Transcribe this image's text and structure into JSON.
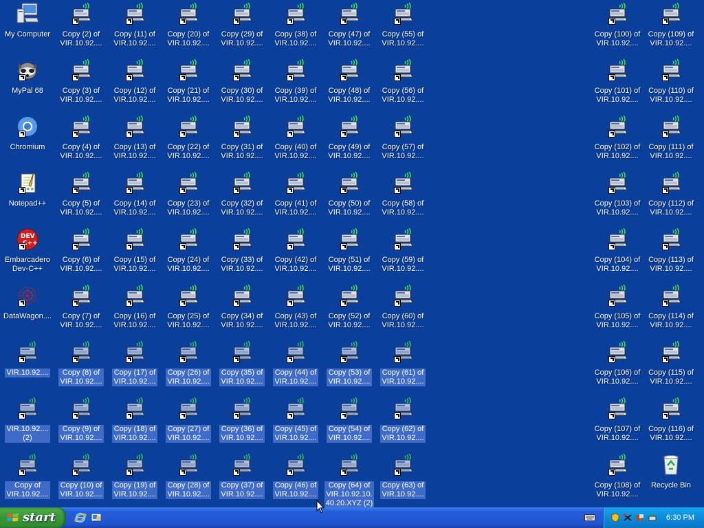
{
  "desktop": {
    "system_icons": [
      {
        "label": "My Computer",
        "icon": "my-computer-icon"
      },
      {
        "label": "MyPal 68",
        "icon": "mypal-browser-icon"
      },
      {
        "label": "Chromium",
        "icon": "chromium-icon"
      },
      {
        "label": "Notepad++",
        "icon": "notepad-plus-plus-icon"
      },
      {
        "label": "Embarcadero\nDev-C++",
        "icon": "devcpp-icon"
      },
      {
        "label": "DataWagon....",
        "icon": "datawagon-icon"
      }
    ],
    "connection_icon_name": "remote-desktop-connection-icon",
    "left_columns": [
      [
        "Copy (2) of\nVIR.10.92....",
        "Copy (3) of\nVIR.10.92....",
        "Copy (4) of\nVIR.10.92....",
        "Copy (5) of\nVIR.10.92....",
        "Copy (6) of\nVIR.10.92....",
        "Copy (7) of\nVIR.10.92....",
        "Copy (8) of\nVIR.10.92....",
        "Copy (9) of\nVIR.10.92....",
        "Copy (10) of\nVIR.10.92...."
      ],
      [
        "Copy (11) of\nVIR.10.92....",
        "Copy (12) of\nVIR.10.92....",
        "Copy (13) of\nVIR.10.92....",
        "Copy (14) of\nVIR.10.92....",
        "Copy (15) of\nVIR.10.92....",
        "Copy (16) of\nVIR.10.92....",
        "Copy (17) of\nVIR.10.92....",
        "Copy (18) of\nVIR.10.92....",
        "Copy (19) of\nVIR.10.92...."
      ],
      [
        "Copy (20) of\nVIR.10.92....",
        "Copy (21) of\nVIR.10.92....",
        "Copy (22) of\nVIR.10.92....",
        "Copy (23) of\nVIR.10.92....",
        "Copy (24) of\nVIR.10.92....",
        "Copy (25) of\nVIR.10.92....",
        "Copy (26) of\nVIR.10.92....",
        "Copy (27) of\nVIR.10.92....",
        "Copy (28) of\nVIR.10.92...."
      ],
      [
        "Copy (29) of\nVIR.10.92....",
        "Copy (30) of\nVIR.10.92....",
        "Copy (31) of\nVIR.10.92....",
        "Copy (32) of\nVIR.10.92....",
        "Copy (33) of\nVIR.10.92....",
        "Copy (34) of\nVIR.10.92....",
        "Copy (35) of\nVIR.10.92....",
        "Copy (36) of\nVIR.10.92....",
        "Copy (37) of\nVIR.10.92...."
      ],
      [
        "Copy (38) of\nVIR.10.92....",
        "Copy (39) of\nVIR.10.92....",
        "Copy (40) of\nVIR.10.92....",
        "Copy (41) of\nVIR.10.92....",
        "Copy (42) of\nVIR.10.92....",
        "Copy (43) of\nVIR.10.92....",
        "Copy (44) of\nVIR.10.92....",
        "Copy (45) of\nVIR.10.92....",
        "Copy (46) of\nVIR.10.92...."
      ],
      [
        "Copy (47) of\nVIR.10.92....",
        "Copy (48) of\nVIR.10.92....",
        "Copy (49) of\nVIR.10.92....",
        "Copy (50) of\nVIR.10.92....",
        "Copy (51) of\nVIR.10.92....",
        "Copy (52) of\nVIR.10.92....",
        "Copy (53) of\nVIR.10.92....",
        "Copy (54) of\nVIR.10.92....",
        "Copy (64) of\nVIR.10.92.10.\n40.20.XYZ (2)"
      ],
      [
        "Copy (55) of\nVIR.10.92....",
        "Copy (56) of\nVIR.10.92....",
        "Copy (57) of\nVIR.10.92....",
        "Copy (58) of\nVIR.10.92....",
        "Copy (59) of\nVIR.10.92....",
        "Copy (60) of\nVIR.10.92....",
        "Copy (61) of\nVIR.10.92....",
        "Copy (62) of\nVIR.10.92....",
        "Copy (63) of\nVIR.10.92...."
      ]
    ],
    "first_column_lower": [
      "VIR.10.92....",
      "VIR.10.92....\n(2)",
      "Copy of\nVIR.10.92...."
    ],
    "right_columns": [
      [
        "Copy (100) of\nVIR.10.92....",
        "Copy (101) of\nVIR.10.92....",
        "Copy (102) of\nVIR.10.92....",
        "Copy (103) of\nVIR.10.92....",
        "Copy (104) of\nVIR.10.92....",
        "Copy (105) of\nVIR.10.92....",
        "Copy (106) of\nVIR.10.92....",
        "Copy (107) of\nVIR.10.92....",
        "Copy (108) of\nVIR.10.92...."
      ],
      [
        "Copy (109) of\nVIR.10.92....",
        "Copy (110) of\nVIR.10.92....",
        "Copy (111) of\nVIR.10.92....",
        "Copy (112) of\nVIR.10.92....",
        "Copy (113) of\nVIR.10.92....",
        "Copy (114) of\nVIR.10.92....",
        "Copy (115) of\nVIR.10.92....",
        "Copy (116) of\nVIR.10.92....",
        "Recycle Bin"
      ]
    ],
    "selected_rows_from": 6,
    "background_color": "#0a3f9c",
    "selection_color": "#3d6bc7"
  },
  "taskbar": {
    "start_label": "start",
    "quick_launch": [
      "internet-explorer-icon",
      "show-desktop-icon"
    ],
    "tray_icons": [
      "keyboard-icon",
      "security-shield-icon",
      "network-icon",
      "volume-icon",
      "safely-remove-icon"
    ],
    "clock": "6:30 PM"
  }
}
